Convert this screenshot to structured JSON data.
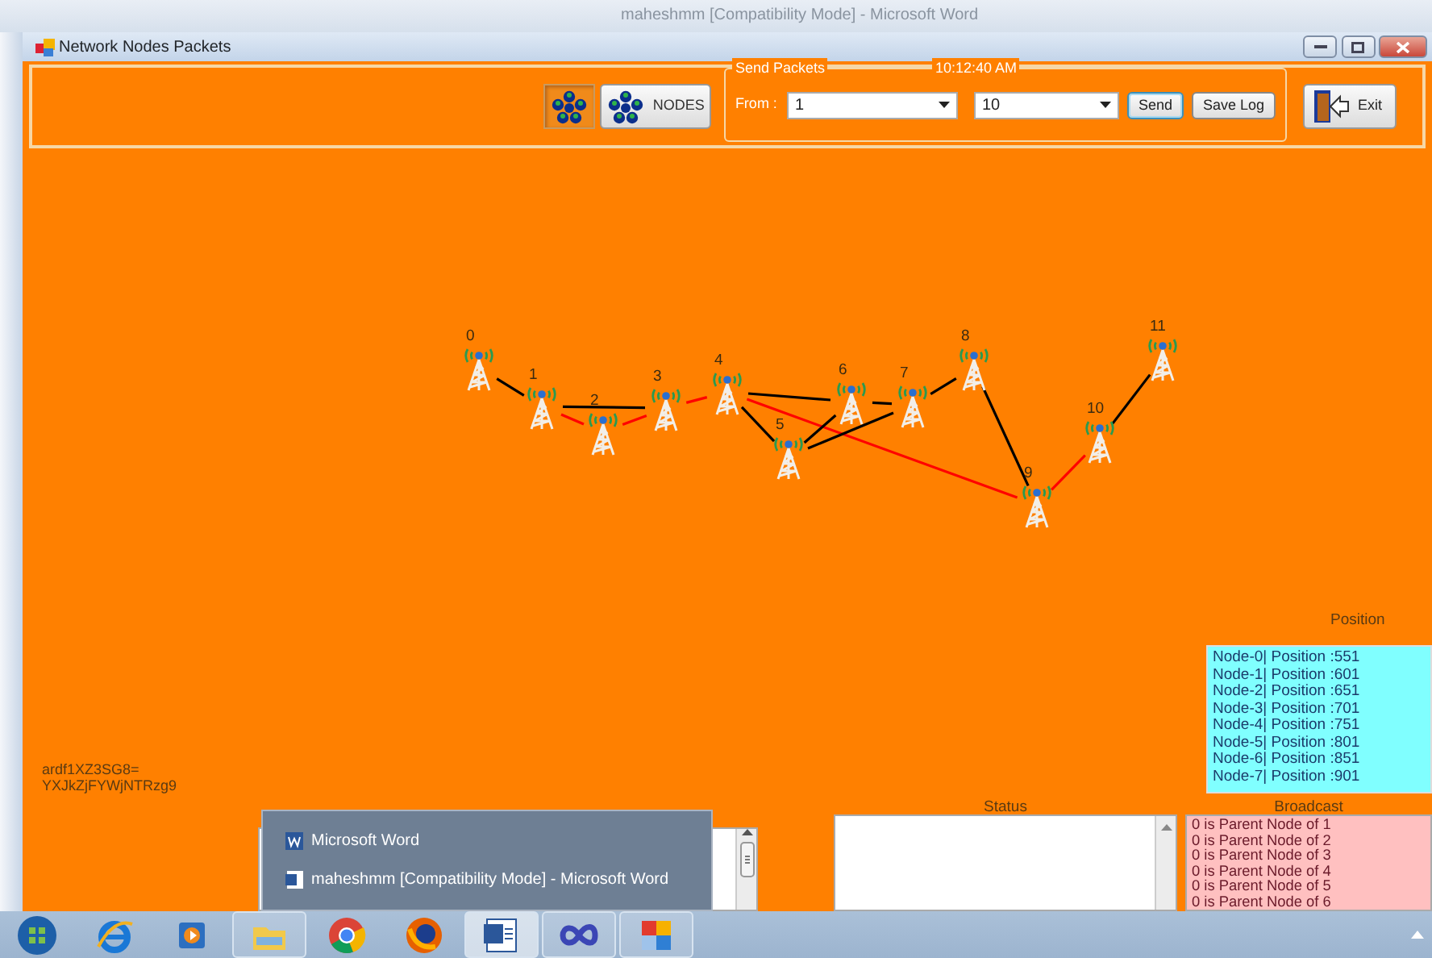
{
  "background_window": {
    "title": "maheshmm [Compatibility Mode] - Microsoft Word"
  },
  "window": {
    "title": "Network Nodes Packets"
  },
  "toolbar": {
    "layout_button": {
      "selected": true
    },
    "nodes_button": {
      "label": "NODES",
      "selected": false
    },
    "send_packets": {
      "title": "Send Packets",
      "time": "10:12:40 AM",
      "from_label": "From :",
      "from_value": "1",
      "to_value": "10",
      "send": "Send",
      "save_log": "Save Log"
    },
    "exit": "Exit"
  },
  "network": {
    "nodes": [
      {
        "label": "0"
      },
      {
        "label": "1"
      },
      {
        "label": "2"
      },
      {
        "label": "3"
      },
      {
        "label": "4"
      },
      {
        "label": "5"
      },
      {
        "label": "6"
      },
      {
        "label": "7"
      },
      {
        "label": "8"
      },
      {
        "label": "9"
      },
      {
        "label": "10"
      },
      {
        "label": "11"
      }
    ],
    "links": [
      {
        "color": "#000000"
      },
      {
        "color": "#000000"
      },
      {
        "color": "#ff0000"
      },
      {
        "color": "#ff0000"
      },
      {
        "color": "#ff0000"
      },
      {
        "color": "#000000"
      },
      {
        "color": "#000000"
      },
      {
        "color": "#ff0000"
      },
      {
        "color": "#000000"
      },
      {
        "color": "#000000"
      },
      {
        "color": "#000000"
      },
      {
        "color": "#000000"
      },
      {
        "color": "#000000"
      },
      {
        "color": "#ff0000"
      },
      {
        "color": "#000000"
      }
    ]
  },
  "key_text": [
    "ardf1XZ3SG8=",
    "YXJkZjFYWjNTRzg9"
  ],
  "position": {
    "title": "Position",
    "lines": [
      "Node-0| Position :551",
      "Node-1| Position :601",
      "Node-2| Position :651",
      "Node-3| Position :701",
      "Node-4| Position :751",
      "Node-5| Position :801",
      "Node-6| Position :851",
      "Node-7| Position :901"
    ]
  },
  "status": {
    "title": "Status"
  },
  "broadcast": {
    "title": "Broadcast",
    "lines": [
      "0 is Parent Node of 1",
      "0 is Parent Node of 2",
      "0 is Parent Node of 3",
      "0 is Parent Node of 4",
      "0 is Parent Node of 5",
      "0 is Parent Node of 6"
    ]
  },
  "taskbar_popup": {
    "items": [
      {
        "label": "Microsoft Word",
        "kind": "app"
      },
      {
        "label": "maheshmm [Compatibility Mode] - Microsoft Word",
        "kind": "document"
      }
    ]
  },
  "taskbar": {
    "items": [
      {
        "kind": "start",
        "running": false,
        "selected": false
      },
      {
        "kind": "browser",
        "running": false,
        "selected": false
      },
      {
        "kind": "media",
        "running": false,
        "selected": false
      },
      {
        "kind": "folder",
        "running": true,
        "selected": false
      },
      {
        "kind": "chrome",
        "running": false,
        "selected": false
      },
      {
        "kind": "firefox",
        "running": false,
        "selected": false
      },
      {
        "kind": "word",
        "running": true,
        "selected": true
      },
      {
        "kind": "infinity",
        "running": true,
        "selected": false
      },
      {
        "kind": "tiles",
        "running": true,
        "selected": false
      }
    ]
  }
}
